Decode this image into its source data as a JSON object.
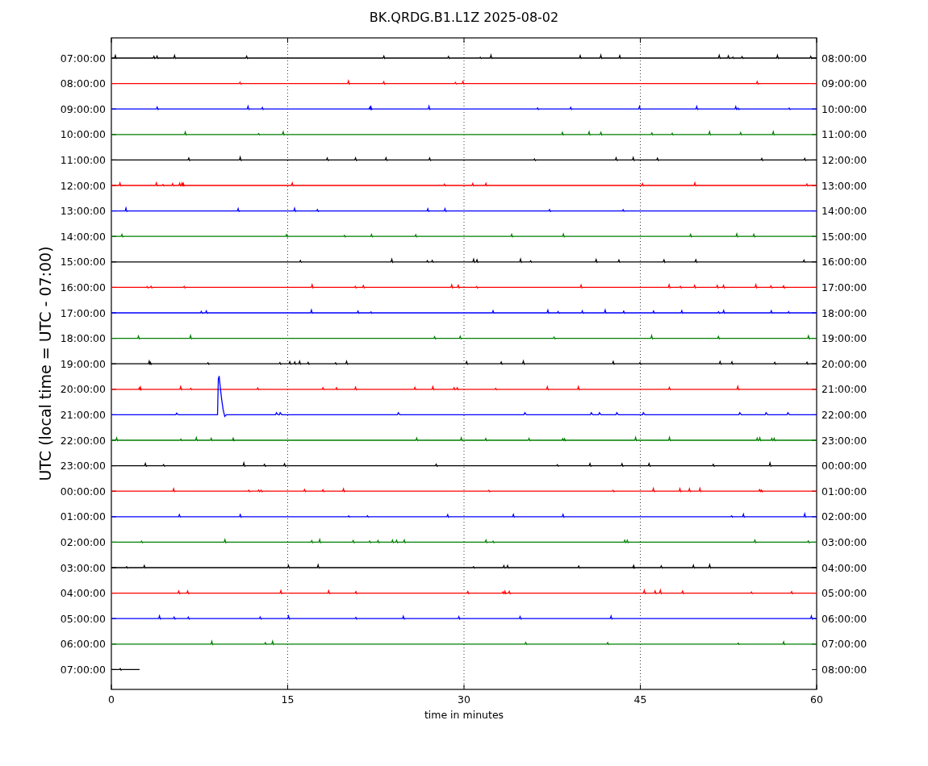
{
  "title": "BK.QRDG.B1.L1Z 2025-08-02",
  "y_axis_label": "UTC (local time = UTC - 07:00)",
  "x_axis_label": "time in minutes",
  "x_ticks": [
    "0",
    "15",
    "30",
    "45",
    "60"
  ],
  "traces": [
    {
      "left_label": "07:00:00",
      "right_label": "08:00:00",
      "color": "#000000",
      "kind": "full"
    },
    {
      "left_label": "08:00:00",
      "right_label": "09:00:00",
      "color": "#ff0000",
      "kind": "full"
    },
    {
      "left_label": "09:00:00",
      "right_label": "10:00:00",
      "color": "#0000ff",
      "kind": "full"
    },
    {
      "left_label": "10:00:00",
      "right_label": "11:00:00",
      "color": "#008000",
      "kind": "full"
    },
    {
      "left_label": "11:00:00",
      "right_label": "12:00:00",
      "color": "#000000",
      "kind": "full"
    },
    {
      "left_label": "12:00:00",
      "right_label": "13:00:00",
      "color": "#ff0000",
      "kind": "full"
    },
    {
      "left_label": "13:00:00",
      "right_label": "14:00:00",
      "color": "#0000ff",
      "kind": "full"
    },
    {
      "left_label": "14:00:00",
      "right_label": "15:00:00",
      "color": "#008000",
      "kind": "full"
    },
    {
      "left_label": "15:00:00",
      "right_label": "16:00:00",
      "color": "#000000",
      "kind": "full"
    },
    {
      "left_label": "16:00:00",
      "right_label": "17:00:00",
      "color": "#ff0000",
      "kind": "full"
    },
    {
      "left_label": "17:00:00",
      "right_label": "18:00:00",
      "color": "#0000ff",
      "kind": "full"
    },
    {
      "left_label": "18:00:00",
      "right_label": "19:00:00",
      "color": "#008000",
      "kind": "full"
    },
    {
      "left_label": "19:00:00",
      "right_label": "20:00:00",
      "color": "#000000",
      "kind": "full"
    },
    {
      "left_label": "20:00:00",
      "right_label": "21:00:00",
      "color": "#ff0000",
      "kind": "full"
    },
    {
      "left_label": "21:00:00",
      "right_label": "22:00:00",
      "color": "#0000ff",
      "kind": "event"
    },
    {
      "left_label": "22:00:00",
      "right_label": "23:00:00",
      "color": "#008000",
      "kind": "full"
    },
    {
      "left_label": "23:00:00",
      "right_label": "00:00:00",
      "color": "#000000",
      "kind": "full"
    },
    {
      "left_label": "00:00:00",
      "right_label": "01:00:00",
      "color": "#ff0000",
      "kind": "full"
    },
    {
      "left_label": "01:00:00",
      "right_label": "02:00:00",
      "color": "#0000ff",
      "kind": "full"
    },
    {
      "left_label": "02:00:00",
      "right_label": "03:00:00",
      "color": "#008000",
      "kind": "full"
    },
    {
      "left_label": "03:00:00",
      "right_label": "04:00:00",
      "color": "#000000",
      "kind": "full"
    },
    {
      "left_label": "04:00:00",
      "right_label": "05:00:00",
      "color": "#ff0000",
      "kind": "full"
    },
    {
      "left_label": "05:00:00",
      "right_label": "06:00:00",
      "color": "#0000ff",
      "kind": "full"
    },
    {
      "left_label": "06:00:00",
      "right_label": "07:00:00",
      "color": "#008000",
      "kind": "full"
    },
    {
      "left_label": "07:00:00",
      "right_label": "08:00:00",
      "color": "#000000",
      "kind": "partial"
    }
  ]
}
